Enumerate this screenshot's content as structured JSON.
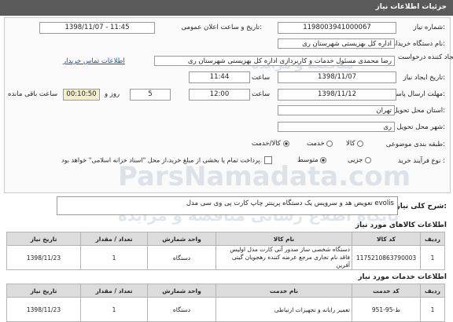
{
  "header": {
    "title": "جزئیات اطلاعات نیاز"
  },
  "form": {
    "need_number_label": "شماره نیاز:",
    "need_number": "1198003941000067",
    "announce_label": "تاریخ و ساعت اعلان عمومی:",
    "announce_value": "1398/11/07 - 11:45",
    "buyer_label": "نام دستگاه خریدار:",
    "buyer_value": "اداره کل بهزیستی شهرستان ری",
    "creator_label": "ایجاد کننده درخواست:",
    "creator_value": "رضا محمدی مسئول خدمات و کاربردازی اداره کل بهزیستی شهرستان ری",
    "contact_link": "اطلاعات تماس خریدار",
    "created_date_label": "تاریخ ایجاد نیاز:",
    "created_date": "1398/11/07",
    "time_label": "ساعت",
    "created_time": "11:44",
    "deadline_label": "مهلت ارسال پاسخ:",
    "deadline_date": "1398/11/12",
    "deadline_time": "12:00",
    "days_value": "5",
    "days_label": "روز و",
    "remaining_value": "00:10:50",
    "remaining_label": "ساعت باقی مانده",
    "province_label": "استان محل تحویل:",
    "province_value": "تهران",
    "city_label": "شهر محل تحویل:",
    "city_value": "ری",
    "category_label": "طبقه بندی موضوعی:",
    "category_options": [
      "کالا",
      "خدمت",
      "کالا/خدمت"
    ],
    "process_label": "نوع فرآیند خرید :",
    "process_options": [
      "جزیی",
      "متوسط"
    ],
    "payment_note": "پرداخت تمام یا بخشی از مبلغ خرید،از محل \"اسناد خزانه اسلامی\" خواهد بود."
  },
  "description": {
    "label": "شرح کلی نیاز:",
    "value": "تعویض هد و سرویس یک دستگاه پرینتر چاپ کارت پی وی سی مدل evolis"
  },
  "goods": {
    "title": "اطلاعات کالاهای مورد نیاز",
    "headers": [
      "ردیف",
      "کد کالا",
      "نام کالا",
      "واحد شمارش",
      "تعداد / مقدار",
      "تاریخ نیاز"
    ],
    "rows": [
      [
        "1",
        "1175210863790003",
        "دستگاه شخصی ساز صدور آنی کارت مدل اوليس فاقد نام تجاری مرجع عرضه کننده رهجويان گيتی آفرين",
        "دستگاه",
        "1",
        "1398/11/23"
      ]
    ]
  },
  "services": {
    "title": "اطلاعات خدمات مورد نیاز",
    "headers": [
      "ردیف",
      "کد خدمت",
      "نام خدمت",
      "واحد شمارش",
      "تعداد / مقدار",
      "تاریخ نیاز"
    ],
    "rows": [
      [
        "1",
        "ط-95-951",
        "تعمیر رایانه و تجهیزات ارتباطی",
        "دستگاه",
        "1",
        "1398/11/23"
      ]
    ]
  },
  "watermark": {
    "line1": "پایگاه اطلاع رسانی مناقصه و مزایده",
    "line2": "ParsNamadata.com",
    "line3": "مناقصه و مزايده"
  },
  "colors": {
    "header_bg": "#5a5a5a",
    "link": "#1a4fa3",
    "table_head_bg": "#dcdcdc"
  }
}
